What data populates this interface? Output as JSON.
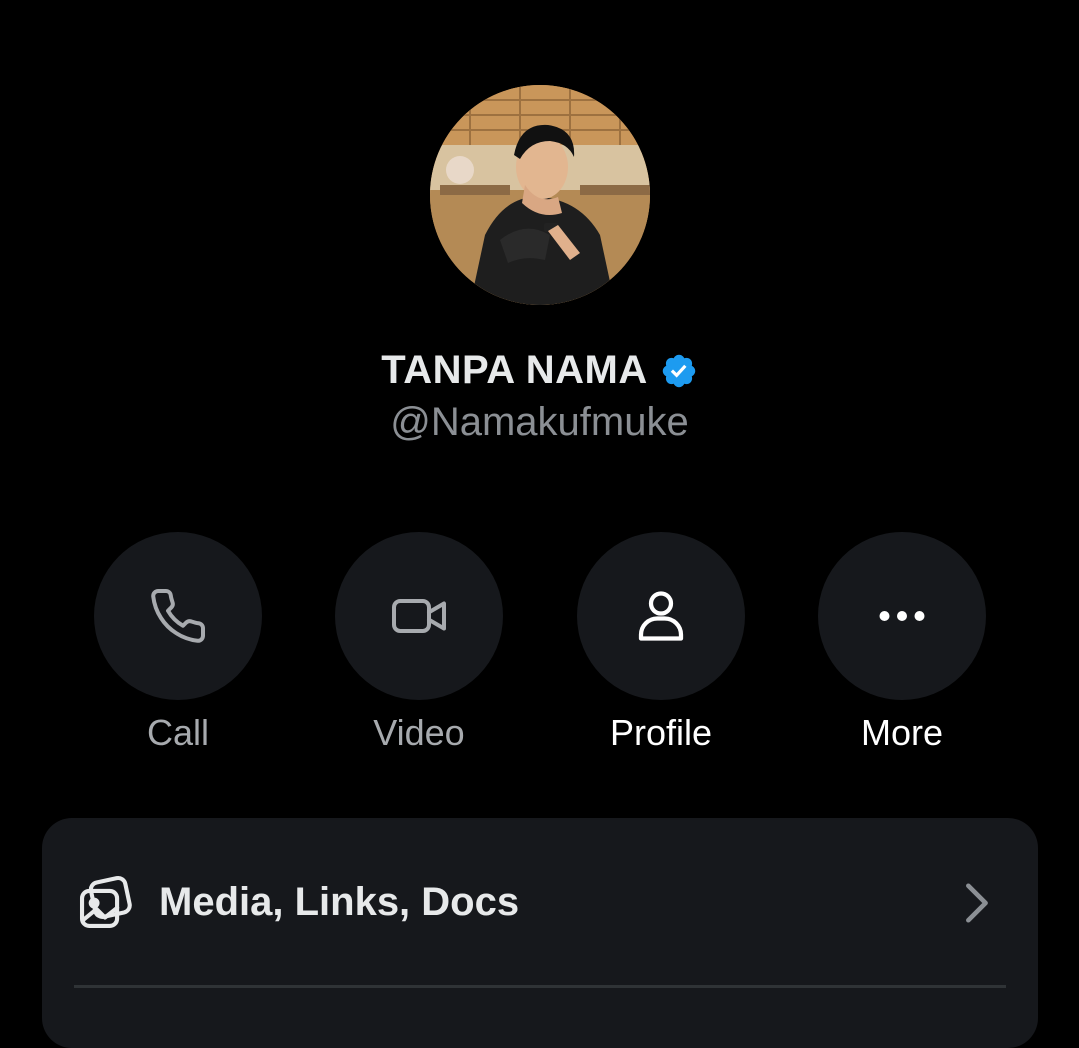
{
  "profile": {
    "display_name": "TANPA NAMA",
    "handle": "@Namakufmuke",
    "verified": true,
    "verified_color": "#1d9bf0"
  },
  "actions": [
    {
      "label": "Call",
      "icon": "phone-icon"
    },
    {
      "label": "Video",
      "icon": "video-camera-icon"
    },
    {
      "label": "Profile",
      "icon": "person-icon"
    },
    {
      "label": "More",
      "icon": "more-dots-icon"
    }
  ],
  "sections": {
    "media": {
      "label": "Media, Links, Docs",
      "icon": "media-gallery-icon"
    }
  },
  "colors": {
    "background": "#000000",
    "surface": "#16181c",
    "primary_text": "#e7e9ea",
    "secondary_text": "#8b8f94",
    "accent": "#1d9bf0"
  }
}
